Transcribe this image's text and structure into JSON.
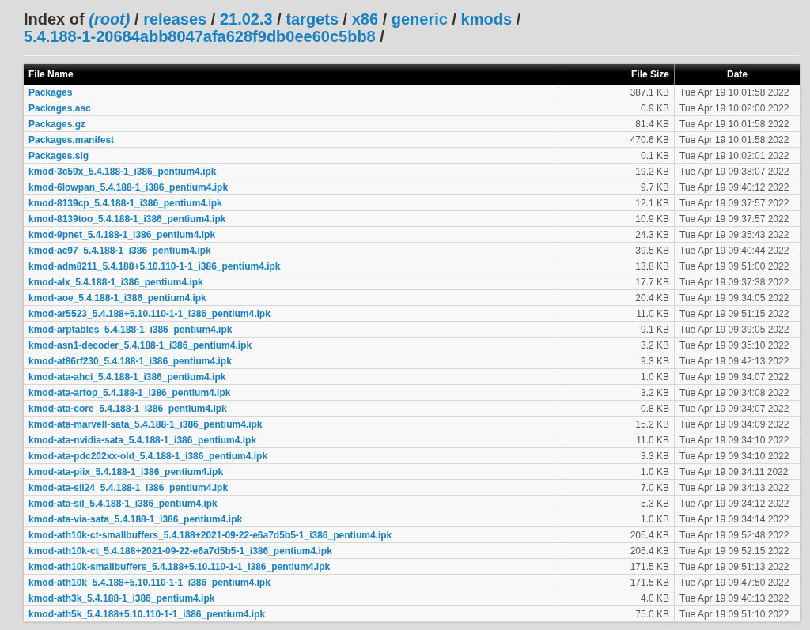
{
  "title": {
    "prefix": "Index of",
    "crumbs": [
      {
        "label": "(root)",
        "separator": "/"
      },
      {
        "label": "releases",
        "separator": "/"
      },
      {
        "label": "21.02.3",
        "separator": "/"
      },
      {
        "label": "targets",
        "separator": "/"
      },
      {
        "label": "x86",
        "separator": "/"
      },
      {
        "label": "generic",
        "separator": "/"
      },
      {
        "label": "kmods",
        "separator": "/"
      },
      {
        "label": "5.4.188-1-20684abb8047afa628f9db0ee60c5bb8",
        "separator": "/"
      }
    ]
  },
  "table": {
    "columns": [
      "File Name",
      "File Size",
      "Date"
    ],
    "rows": [
      [
        "Packages",
        "387.1 KB",
        "Tue Apr 19 10:01:58 2022"
      ],
      [
        "Packages.asc",
        "0.9 KB",
        "Tue Apr 19 10:02:00 2022"
      ],
      [
        "Packages.gz",
        "81.4 KB",
        "Tue Apr 19 10:01:58 2022"
      ],
      [
        "Packages.manifest",
        "470.6 KB",
        "Tue Apr 19 10:01:58 2022"
      ],
      [
        "Packages.sig",
        "0.1 KB",
        "Tue Apr 19 10:02:01 2022"
      ],
      [
        "kmod-3c59x_5.4.188-1_i386_pentium4.ipk",
        "19.2 KB",
        "Tue Apr 19 09:38:07 2022"
      ],
      [
        "kmod-6lowpan_5.4.188-1_i386_pentium4.ipk",
        "9.7 KB",
        "Tue Apr 19 09:40:12 2022"
      ],
      [
        "kmod-8139cp_5.4.188-1_i386_pentium4.ipk",
        "12.1 KB",
        "Tue Apr 19 09:37:57 2022"
      ],
      [
        "kmod-8139too_5.4.188-1_i386_pentium4.ipk",
        "10.9 KB",
        "Tue Apr 19 09:37:57 2022"
      ],
      [
        "kmod-9pnet_5.4.188-1_i386_pentium4.ipk",
        "24.3 KB",
        "Tue Apr 19 09:35:43 2022"
      ],
      [
        "kmod-ac97_5.4.188-1_i386_pentium4.ipk",
        "39.5 KB",
        "Tue Apr 19 09:40:44 2022"
      ],
      [
        "kmod-adm8211_5.4.188+5.10.110-1-1_i386_pentium4.ipk",
        "13.8 KB",
        "Tue Apr 19 09:51:00 2022"
      ],
      [
        "kmod-alx_5.4.188-1_i386_pentium4.ipk",
        "17.7 KB",
        "Tue Apr 19 09:37:38 2022"
      ],
      [
        "kmod-aoe_5.4.188-1_i386_pentium4.ipk",
        "20.4 KB",
        "Tue Apr 19 09:34:05 2022"
      ],
      [
        "kmod-ar5523_5.4.188+5.10.110-1-1_i386_pentium4.ipk",
        "11.0 KB",
        "Tue Apr 19 09:51:15 2022"
      ],
      [
        "kmod-arptables_5.4.188-1_i386_pentium4.ipk",
        "9.1 KB",
        "Tue Apr 19 09:39:05 2022"
      ],
      [
        "kmod-asn1-decoder_5.4.188-1_i386_pentium4.ipk",
        "3.2 KB",
        "Tue Apr 19 09:35:10 2022"
      ],
      [
        "kmod-at86rf230_5.4.188-1_i386_pentium4.ipk",
        "9.3 KB",
        "Tue Apr 19 09:42:13 2022"
      ],
      [
        "kmod-ata-ahci_5.4.188-1_i386_pentium4.ipk",
        "1.0 KB",
        "Tue Apr 19 09:34:07 2022"
      ],
      [
        "kmod-ata-artop_5.4.188-1_i386_pentium4.ipk",
        "3.2 KB",
        "Tue Apr 19 09:34:08 2022"
      ],
      [
        "kmod-ata-core_5.4.188-1_i386_pentium4.ipk",
        "0.8 KB",
        "Tue Apr 19 09:34:07 2022"
      ],
      [
        "kmod-ata-marvell-sata_5.4.188-1_i386_pentium4.ipk",
        "15.2 KB",
        "Tue Apr 19 09:34:09 2022"
      ],
      [
        "kmod-ata-nvidia-sata_5.4.188-1_i386_pentium4.ipk",
        "11.0 KB",
        "Tue Apr 19 09:34:10 2022"
      ],
      [
        "kmod-ata-pdc202xx-old_5.4.188-1_i386_pentium4.ipk",
        "3.3 KB",
        "Tue Apr 19 09:34:10 2022"
      ],
      [
        "kmod-ata-piix_5.4.188-1_i386_pentium4.ipk",
        "1.0 KB",
        "Tue Apr 19 09:34:11 2022"
      ],
      [
        "kmod-ata-sil24_5.4.188-1_i386_pentium4.ipk",
        "7.0 KB",
        "Tue Apr 19 09:34:13 2022"
      ],
      [
        "kmod-ata-sil_5.4.188-1_i386_pentium4.ipk",
        "5.3 KB",
        "Tue Apr 19 09:34:12 2022"
      ],
      [
        "kmod-ata-via-sata_5.4.188-1_i386_pentium4.ipk",
        "1.0 KB",
        "Tue Apr 19 09:34:14 2022"
      ],
      [
        "kmod-ath10k-ct-smallbuffers_5.4.188+2021-09-22-e6a7d5b5-1_i386_pentium4.ipk",
        "205.4 KB",
        "Tue Apr 19 09:52:48 2022"
      ],
      [
        "kmod-ath10k-ct_5.4.188+2021-09-22-e6a7d5b5-1_i386_pentium4.ipk",
        "205.4 KB",
        "Tue Apr 19 09:52:15 2022"
      ],
      [
        "kmod-ath10k-smallbuffers_5.4.188+5.10.110-1-1_i386_pentium4.ipk",
        "171.5 KB",
        "Tue Apr 19 09:51:13 2022"
      ],
      [
        "kmod-ath10k_5.4.188+5.10.110-1-1_i386_pentium4.ipk",
        "171.5 KB",
        "Tue Apr 19 09:47:50 2022"
      ],
      [
        "kmod-ath3k_5.4.188-1_i386_pentium4.ipk",
        "4.0 KB",
        "Tue Apr 19 09:40:13 2022"
      ],
      [
        "kmod-ath5k_5.4.188+5.10.110-1-1_i386_pentium4.ipk",
        "75.0 KB",
        "Tue Apr 19 09:51:10 2022"
      ]
    ]
  }
}
